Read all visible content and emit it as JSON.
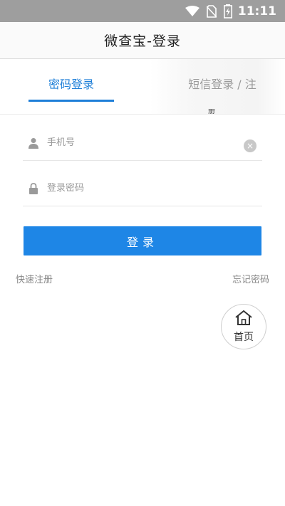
{
  "status_bar": {
    "time": "11:11",
    "icons": [
      "wifi-icon",
      "no-sim-icon",
      "battery-charging-icon"
    ]
  },
  "header": {
    "title": "微查宝-登录"
  },
  "tabs": [
    {
      "label": "密码登录",
      "active": true
    },
    {
      "label": "短信登录 / 注",
      "active": false
    }
  ],
  "tabs_overflow_glyph": "册",
  "form": {
    "phone_placeholder": "手机号",
    "phone_icon": "user-icon",
    "clear_icon": "clear-icon",
    "clear_glyph": "×",
    "password_placeholder": "登录密码",
    "password_icon": "lock-icon"
  },
  "login_button": "登录",
  "links": {
    "register": "快速注册",
    "forgot": "忘记密码"
  },
  "home_fab": {
    "label": "首页",
    "icon": "home-icon"
  },
  "colors": {
    "accent": "#1e86e6",
    "tab_active": "#1e7fd8",
    "status_bar": "#9e9e9e"
  }
}
